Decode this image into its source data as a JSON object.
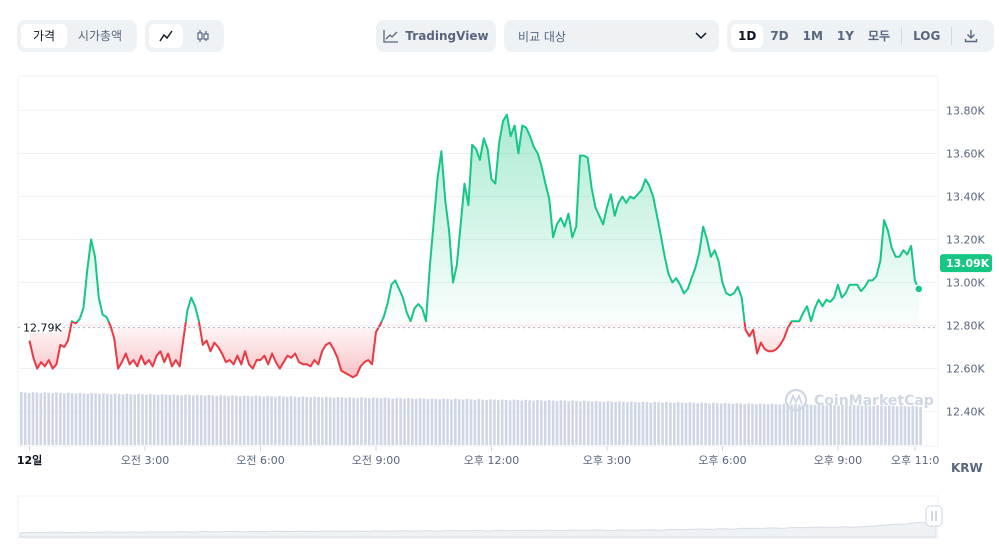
{
  "toolbar": {
    "metric_tabs": [
      "가격",
      "시가총액"
    ],
    "tradingview_label": "TradingView",
    "compare_placeholder": "비교 대상",
    "timeframes": [
      "1D",
      "7D",
      "1M",
      "1Y",
      "모두"
    ],
    "log_label": "LOG",
    "active_timeframe": "1D"
  },
  "watermark": "CoinMarketCap",
  "currency_label": "KRW",
  "chart_data": {
    "type": "area",
    "title": "",
    "xlabel": "",
    "ylabel": "",
    "y_tick_labels": [
      "13.80K",
      "13.60K",
      "13.40K",
      "13.20K",
      "13.00K",
      "12.80K",
      "12.60K",
      "12.40K"
    ],
    "y_tick_values": [
      13.8,
      13.6,
      13.4,
      13.2,
      13.0,
      12.8,
      12.6,
      12.4
    ],
    "ylim": [
      12.24,
      13.96
    ],
    "x_tick_labels": [
      "12일",
      "오전 3:00",
      "오전 6:00",
      "오전 9:00",
      "오후 12:00",
      "오후 3:00",
      "오후 6:00",
      "오후 9:00",
      "오후 11:0"
    ],
    "x_tick_hours": [
      0,
      3,
      6,
      9,
      12,
      15,
      18,
      21,
      23
    ],
    "xlim_hours": [
      -0.3,
      23.6
    ],
    "reference": {
      "value": 12.79,
      "label": "12.79K"
    },
    "current": {
      "value": 13.09,
      "label": "13.09K"
    },
    "colors": {
      "above": "#16c784",
      "below": "#ea3943",
      "volume": "#cfd6e4"
    },
    "series": [
      {
        "unit": "K KRW",
        "hours": [
          0.0,
          0.1,
          0.2,
          0.3,
          0.4,
          0.5,
          0.6,
          0.7,
          0.8,
          0.9,
          1.0,
          1.1,
          1.2,
          1.3,
          1.4,
          1.5,
          1.6,
          1.7,
          1.8,
          1.9,
          2.0,
          2.1,
          2.2,
          2.3,
          2.4,
          2.5,
          2.6,
          2.7,
          2.8,
          2.9,
          3.0,
          3.1,
          3.2,
          3.3,
          3.4,
          3.5,
          3.6,
          3.7,
          3.8,
          3.9,
          4.0,
          4.1,
          4.2,
          4.3,
          4.4,
          4.5,
          4.6,
          4.7,
          4.8,
          4.9,
          5.0,
          5.1,
          5.2,
          5.3,
          5.4,
          5.5,
          5.6,
          5.7,
          5.8,
          5.9,
          6.0,
          6.1,
          6.2,
          6.3,
          6.4,
          6.5,
          6.6,
          6.7,
          6.8,
          6.9,
          7.0,
          7.1,
          7.2,
          7.3,
          7.4,
          7.5,
          7.6,
          7.7,
          7.8,
          7.9,
          8.0,
          8.1,
          8.2,
          8.3,
          8.4,
          8.5,
          8.6,
          8.7,
          8.8,
          8.9,
          9.0,
          9.1,
          9.2,
          9.3,
          9.4,
          9.5,
          9.6,
          9.7,
          9.8,
          9.9,
          10.0,
          10.1,
          10.2,
          10.3,
          10.4,
          10.5,
          10.6,
          10.7,
          10.8,
          10.9,
          11.0,
          11.1,
          11.2,
          11.3,
          11.4,
          11.5,
          11.6,
          11.7,
          11.8,
          11.9,
          12.0,
          12.1,
          12.2,
          12.3,
          12.4,
          12.5,
          12.6,
          12.7,
          12.8,
          12.9,
          13.0,
          13.1,
          13.2,
          13.3,
          13.4,
          13.5,
          13.6,
          13.7,
          13.8,
          13.9,
          14.0,
          14.1,
          14.2,
          14.3,
          14.4,
          14.5,
          14.6,
          14.7,
          14.8,
          14.9,
          15.0,
          15.1,
          15.2,
          15.3,
          15.4,
          15.5,
          15.6,
          15.7,
          15.8,
          15.9,
          16.0,
          16.1,
          16.2,
          16.3,
          16.4,
          16.5,
          16.6,
          16.7,
          16.8,
          16.9,
          17.0,
          17.1,
          17.2,
          17.3,
          17.4,
          17.5,
          17.6,
          17.7,
          17.8,
          17.9,
          18.0,
          18.1,
          18.2,
          18.3,
          18.4,
          18.5,
          18.6,
          18.7,
          18.8,
          18.9,
          19.0,
          19.1,
          19.2,
          19.3,
          19.4,
          19.5,
          19.6,
          19.7,
          19.8,
          19.9,
          20.0,
          20.1,
          20.2,
          20.3,
          20.4,
          20.5,
          20.6,
          20.7,
          20.8,
          20.9,
          21.0,
          21.1,
          21.2,
          21.3,
          21.4,
          21.5,
          21.6,
          21.7,
          21.8,
          21.9,
          22.0,
          22.1,
          22.2,
          22.3,
          22.4,
          22.5,
          22.6,
          22.7,
          22.8,
          22.9,
          23.0,
          23.1
        ],
        "values": [
          12.73,
          12.65,
          12.6,
          12.63,
          12.61,
          12.64,
          12.6,
          12.62,
          12.71,
          12.7,
          12.73,
          12.82,
          12.81,
          12.83,
          12.88,
          13.06,
          13.2,
          13.12,
          12.93,
          12.85,
          12.84,
          12.8,
          12.74,
          12.6,
          12.63,
          12.67,
          12.62,
          12.64,
          12.61,
          12.66,
          12.62,
          12.64,
          12.61,
          12.66,
          12.68,
          12.63,
          12.67,
          12.61,
          12.64,
          12.61,
          12.74,
          12.87,
          12.93,
          12.89,
          12.82,
          12.71,
          12.73,
          12.68,
          12.72,
          12.7,
          12.67,
          12.63,
          12.64,
          12.62,
          12.66,
          12.62,
          12.68,
          12.62,
          12.6,
          12.64,
          12.64,
          12.66,
          12.62,
          12.67,
          12.63,
          12.6,
          12.63,
          12.66,
          12.65,
          12.67,
          12.63,
          12.62,
          12.62,
          12.61,
          12.64,
          12.62,
          12.68,
          12.71,
          12.72,
          12.69,
          12.65,
          12.59,
          12.58,
          12.57,
          12.56,
          12.57,
          12.61,
          12.63,
          12.64,
          12.62,
          12.77,
          12.8,
          12.84,
          12.9,
          12.99,
          13.01,
          12.97,
          12.93,
          12.86,
          12.82,
          12.88,
          12.9,
          12.88,
          12.82,
          13.08,
          13.28,
          13.49,
          13.61,
          13.38,
          13.24,
          13.0,
          13.08,
          13.27,
          13.46,
          13.36,
          13.64,
          13.62,
          13.57,
          13.67,
          13.62,
          13.48,
          13.46,
          13.65,
          13.75,
          13.78,
          13.68,
          13.73,
          13.6,
          13.73,
          13.72,
          13.68,
          13.63,
          13.6,
          13.54,
          13.46,
          13.39,
          13.21,
          13.27,
          13.3,
          13.26,
          13.32,
          13.21,
          13.26,
          13.59,
          13.59,
          13.58,
          13.44,
          13.35,
          13.31,
          13.27,
          13.35,
          13.41,
          13.31,
          13.37,
          13.4,
          13.37,
          13.4,
          13.39,
          13.41,
          13.43,
          13.48,
          13.45,
          13.4,
          13.31,
          13.22,
          13.12,
          13.04,
          13.0,
          13.02,
          12.99,
          12.95,
          12.97,
          13.02,
          13.07,
          13.14,
          13.26,
          13.2,
          13.12,
          13.15,
          13.1,
          13.0,
          12.95,
          12.94,
          12.95,
          12.98,
          12.93,
          12.78,
          12.75,
          12.78,
          12.67,
          12.72,
          12.69,
          12.68,
          12.68,
          12.69,
          12.71,
          12.74,
          12.79,
          12.82,
          12.82,
          12.82,
          12.86,
          12.89,
          12.82,
          12.88,
          12.92,
          12.89,
          12.92,
          12.91,
          12.93,
          12.99,
          12.93,
          12.95,
          12.99,
          12.99,
          12.99,
          12.96,
          12.98,
          13.01,
          13.01,
          13.03,
          13.1,
          13.29,
          13.24,
          13.16,
          13.12,
          13.12,
          13.15,
          13.13,
          13.17,
          13.01,
          12.97,
          12.97,
          12.98,
          13.35,
          13.17,
          13.21,
          13.25,
          13.22,
          13.23,
          13.15,
          13.27,
          13.28,
          13.29,
          13.23,
          13.26,
          13.13,
          13.02,
          13.09
        ]
      }
    ]
  }
}
